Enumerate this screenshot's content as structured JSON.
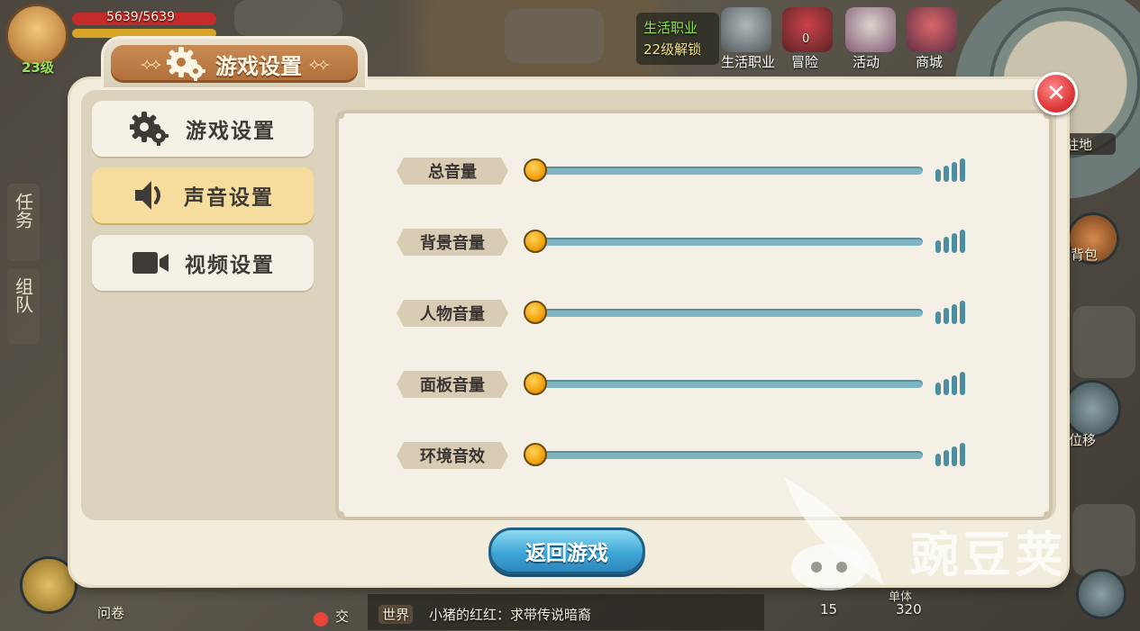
{
  "hud": {
    "hp": "5639/5639",
    "level": "23级",
    "life_job": [
      "生活职业",
      "22级解锁"
    ],
    "top_menu": [
      {
        "label": "生活职业",
        "icon": "anvil-icon"
      },
      {
        "label": "冒险",
        "icon": "helmet-icon",
        "badge": "0"
      },
      {
        "label": "活动",
        "icon": "gift-icon"
      },
      {
        "label": "商城",
        "icon": "gem-icon"
      }
    ],
    "side_tabs": [
      {
        "label": "任务",
        "icon": "quest-tab"
      },
      {
        "label": "组队",
        "icon": "team-tab"
      }
    ],
    "right_labels": {
      "home": "驻地",
      "bag": "背包",
      "move": "位移"
    },
    "bottom": {
      "survey": "问卷",
      "social": "交",
      "chat_channel": "世界",
      "chat_message": "小猪的红红：求带传说暗裔",
      "counter_a": "15",
      "counter_b_label": "单体",
      "counter_b": "320"
    }
  },
  "dialog": {
    "title": "游戏设置",
    "menu": [
      {
        "label": "游戏设置",
        "icon": "gear-icon",
        "active": false
      },
      {
        "label": "声音设置",
        "icon": "speaker-icon",
        "active": true
      },
      {
        "label": "视频设置",
        "icon": "video-camera-icon",
        "active": false
      }
    ],
    "sliders": [
      {
        "label": "总音量",
        "value": 0
      },
      {
        "label": "背景音量",
        "value": 0
      },
      {
        "label": "人物音量",
        "value": 0
      },
      {
        "label": "面板音量",
        "value": 0
      },
      {
        "label": "环境音效",
        "value": 0
      }
    ],
    "return_button": "返回游戏",
    "close_symbol": "✕"
  },
  "watermark": "豌豆荚",
  "colors": {
    "accent_orange": "#f2a30f",
    "track_blue": "#7fb4c2",
    "active_tab": "#f7dd9d",
    "close_red": "#de3b3b",
    "button_blue": "#3ea6d6"
  }
}
